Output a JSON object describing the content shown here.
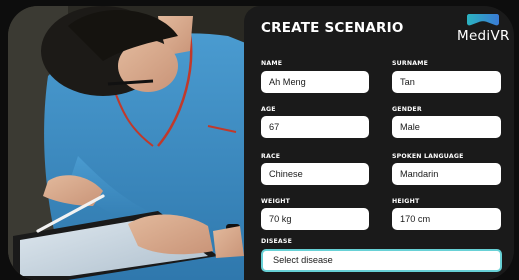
{
  "header": {
    "title": "CREATE SCENARIO",
    "logo_text": "MediVR",
    "logo_colors": [
      "#2bb3c0",
      "#3a7bd5"
    ]
  },
  "form": {
    "name": {
      "label": "NAME",
      "value": "Ah Meng"
    },
    "surname": {
      "label": "SURNAME",
      "value": "Tan"
    },
    "age": {
      "label": "AGE",
      "value": "67"
    },
    "gender": {
      "label": "GENDER",
      "value": "Male"
    },
    "race": {
      "label": "RACE",
      "value": "Chinese"
    },
    "spoken_language": {
      "label": "SPOKEN LANGUAGE",
      "value": "Mandarin"
    },
    "weight": {
      "label": "WEIGHT",
      "value": "70 kg"
    },
    "height": {
      "label": "HEIGHT",
      "value": "170 cm"
    },
    "disease": {
      "label": "DISEASE",
      "placeholder": "Select disease"
    }
  },
  "colors": {
    "panel_bg": "#1a1a1a",
    "field_bg": "#ffffff",
    "focus_border": "#68d1d6",
    "scrub_blue": "#3d8fc4"
  }
}
